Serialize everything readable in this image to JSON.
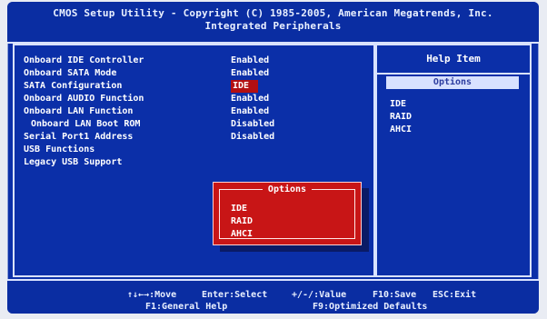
{
  "title": {
    "line1": "CMOS Setup Utility - Copyright (C) 1985-2005, American Megatrends, Inc.",
    "line2": "Integrated Peripherals"
  },
  "main": {
    "rows": [
      {
        "label": "Onboard IDE Controller",
        "value": "Enabled"
      },
      {
        "label": "Onboard SATA Mode",
        "value": "Enabled"
      },
      {
        "label": "SATA Configuration",
        "value": "IDE",
        "selected": true
      },
      {
        "label": "Onboard AUDIO Function",
        "value": "Enabled"
      },
      {
        "label": "Onboard LAN Function",
        "value": "Enabled"
      },
      {
        "label": "Onboard LAN Boot ROM",
        "value": "Disabled",
        "indent": true
      },
      {
        "label": "Serial Port1 Address",
        "value": "Disabled"
      },
      {
        "label": "USB Functions",
        "value": ""
      },
      {
        "label": "Legacy USB Support",
        "value": ""
      }
    ]
  },
  "help": {
    "title": "Help Item",
    "subtitle": "Options",
    "items": [
      "IDE",
      "RAID",
      "AHCI"
    ]
  },
  "popup": {
    "title": "Options",
    "options": [
      "IDE",
      "RAID",
      "AHCI"
    ],
    "selected_index": 0
  },
  "bottom": {
    "line1": {
      "move": "↑↓←→:Move",
      "select": "Enter:Select",
      "value": "+/-/:Value",
      "save": "F10:Save",
      "exit": "ESC:Exit"
    },
    "line2": {
      "help": "F1:General Help",
      "defaults": "F9:Optimized Defaults"
    }
  },
  "colors": {
    "bios_blue": "#0b2fa8",
    "frame": "#d9e2ff",
    "selection_red": "#c81516",
    "help_sub_bg": "#d8e1ff"
  }
}
